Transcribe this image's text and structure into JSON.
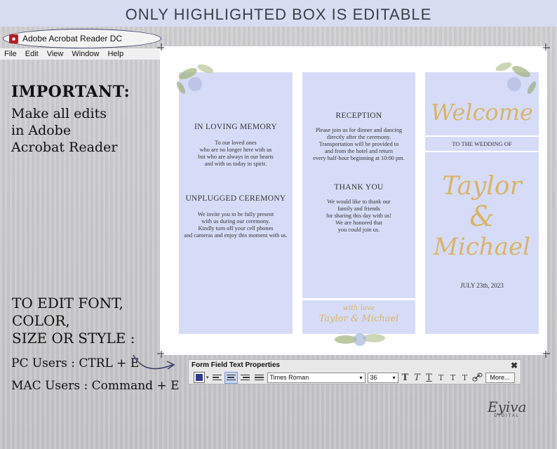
{
  "banner": {
    "text": "ONLY HIGHLIGHTED BOX IS EDITABLE"
  },
  "app": {
    "title": "Adobe Acrobat Reader DC",
    "menu": [
      "File",
      "Edit",
      "View",
      "Window",
      "Help"
    ]
  },
  "instructions": {
    "important": "IMPORTANT:",
    "lines": [
      "Make all edits",
      "in Adobe",
      "Acrobat Reader"
    ],
    "edit_lines": [
      "TO EDIT FONT,",
      "COLOR,",
      "SIZE OR STYLE :"
    ],
    "pc": "PC Users : CTRL + E",
    "mac": "MAC Users : Command + E"
  },
  "panel1": {
    "heading1": "IN LOVING MEMORY",
    "body1": [
      "To our loved ones",
      "who are no longer here with us",
      "but who are always in our hearts",
      "and with us today in spirit."
    ],
    "heading2": "UNPLUGGED CEREMONY",
    "body2": [
      "We invite you to be fully present",
      "with us during our ceremony.",
      "Kindly turn off your cell phones",
      "and cameras and enjoy this moment with us."
    ]
  },
  "panel2": {
    "heading1": "RECEPTION",
    "body1": [
      "Please join us for dinner and dancing",
      "directly after the ceremony.",
      "Transportation will be provided to",
      "and from the hotel and return",
      "every half-hour beginning at 10:00 pm."
    ],
    "heading2": "THANK YOU",
    "body2": [
      "We would like to thank our",
      "family and friends",
      "for sharing this day with us!",
      "We are honored that",
      "you could join us."
    ],
    "footer_with_love": "with love",
    "footer_names": "Taylor & Michael"
  },
  "panel3": {
    "welcome": "Welcome",
    "subtitle": "TO THE WEDDING OF",
    "name1": "Taylor",
    "amp": "&",
    "name2": "Michael",
    "date": "JULY 23th, 2023"
  },
  "toolbar": {
    "title": "Form Field Text Properties",
    "close": "✖",
    "font": "Times Roman",
    "size": "36",
    "more": "More...",
    "style_glyphs": [
      "T",
      "T",
      "T",
      "T",
      "T",
      "T"
    ]
  },
  "logo": {
    "name": "Eyiva",
    "sub": "DIGITAL"
  },
  "colors": {
    "panel": "#d6dcf7",
    "gold": "#d9b467",
    "banner": "#d7dcf1",
    "swatch": "#2f3a8f"
  }
}
